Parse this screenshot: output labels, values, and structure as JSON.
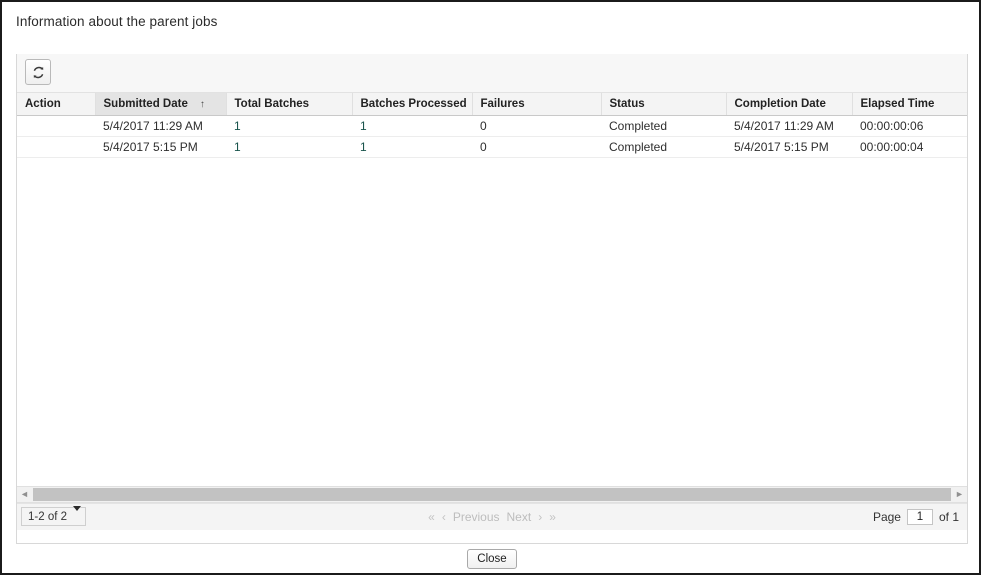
{
  "page": {
    "title": "Information about the parent jobs"
  },
  "toolbar": {
    "refresh_label": "refresh-icon"
  },
  "grid": {
    "columns": [
      {
        "key": "action",
        "label": "Action",
        "sorted": false
      },
      {
        "key": "submitted",
        "label": "Submitted Date",
        "sorted": true,
        "sort_arrow": "↑"
      },
      {
        "key": "total",
        "label": "Total Batches",
        "sorted": false
      },
      {
        "key": "processed",
        "label": "Batches Processed",
        "sorted": false
      },
      {
        "key": "failures",
        "label": "Failures",
        "sorted": false
      },
      {
        "key": "status",
        "label": "Status",
        "sorted": false
      },
      {
        "key": "completion",
        "label": "Completion Date",
        "sorted": false
      },
      {
        "key": "elapsed",
        "label": "Elapsed Time",
        "sorted": false
      }
    ],
    "rows": [
      {
        "action": "",
        "submitted": "5/4/2017 11:29 AM",
        "total": "1",
        "processed": "1",
        "failures": "0",
        "status": "Completed",
        "completion": "5/4/2017 11:29 AM",
        "elapsed": "00:00:00:06"
      },
      {
        "action": "",
        "submitted": "5/4/2017 5:15 PM",
        "total": "1",
        "processed": "1",
        "failures": "0",
        "status": "Completed",
        "completion": "5/4/2017 5:15 PM",
        "elapsed": "00:00:00:04"
      }
    ]
  },
  "scrollbar": {
    "left_arrow": "◄",
    "right_arrow": "►"
  },
  "pager": {
    "range_label": "1-2 of 2",
    "first_glyph": "«",
    "prev_glyph": "‹",
    "previous_label": "Previous",
    "next_label": "Next",
    "next_glyph": "›",
    "last_glyph": "»",
    "page_label": "Page",
    "page_value": "1",
    "of_label": "of 1"
  },
  "footer": {
    "close_label": "Close"
  },
  "colors": {
    "panel_top_bar": "#787a8c",
    "numeric_cell": "#18534b",
    "header_sorted": "#e4e4e4",
    "scroll_thumb": "#c2c2c2",
    "nav_disabled": "#bdbdbd"
  }
}
